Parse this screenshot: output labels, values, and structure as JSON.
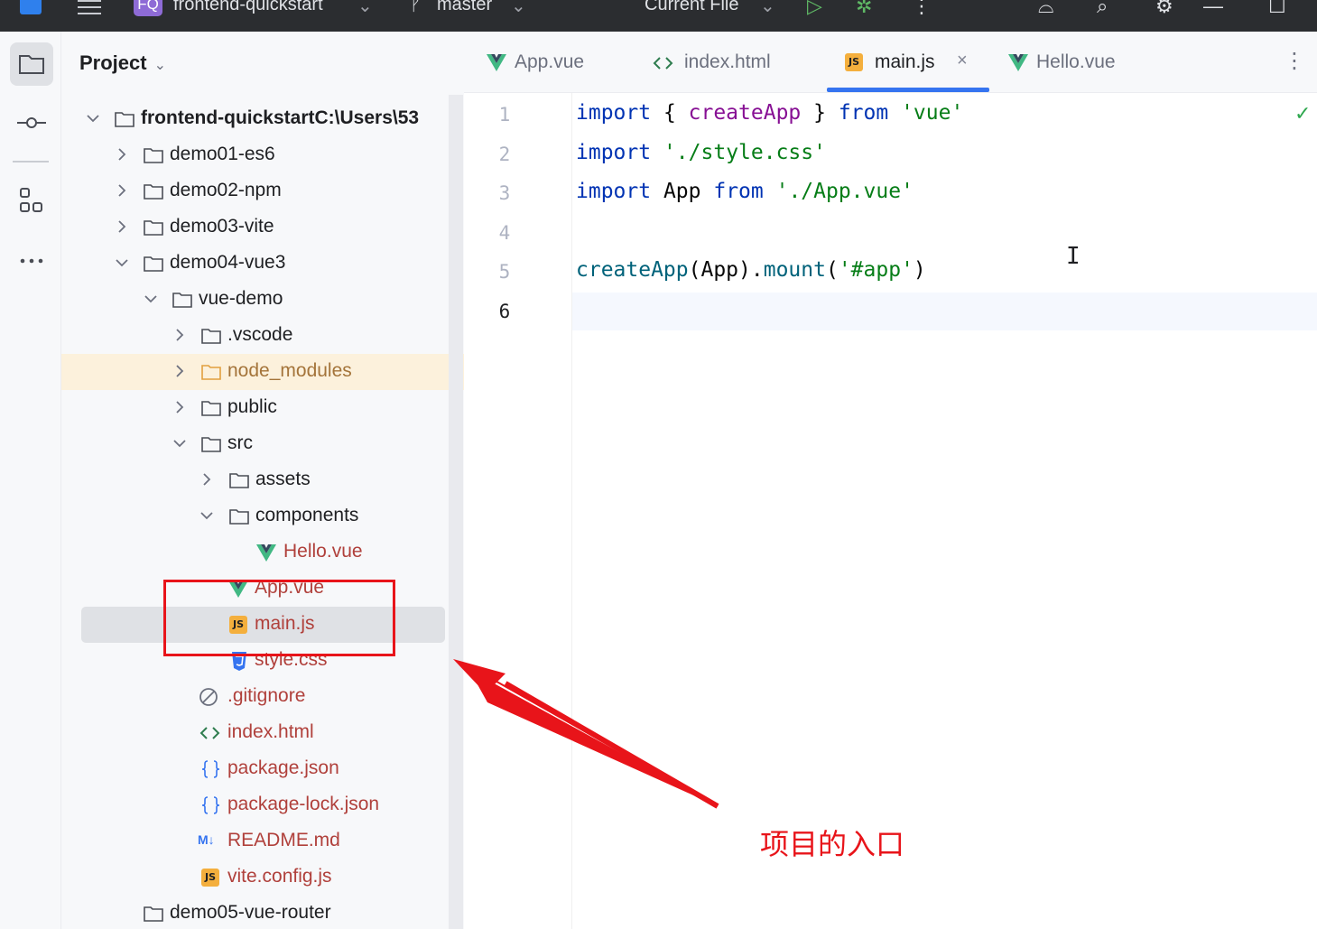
{
  "titlebar": {
    "project_badge": "FQ",
    "project_name": "frontend-quickstart",
    "branch": "master",
    "run_config": "Current File"
  },
  "project_panel": {
    "title": "Project",
    "root_name": "frontend-quickstart",
    "root_path": "C:\\Users\\53",
    "items": [
      {
        "label": "demo01-es6"
      },
      {
        "label": "demo02-npm"
      },
      {
        "label": "demo03-vite"
      },
      {
        "label": "demo04-vue3"
      },
      {
        "label": "vue-demo"
      },
      {
        "label": ".vscode"
      },
      {
        "label": "node_modules"
      },
      {
        "label": "public"
      },
      {
        "label": "src"
      },
      {
        "label": "assets"
      },
      {
        "label": "components"
      },
      {
        "label": "Hello.vue"
      },
      {
        "label": "App.vue"
      },
      {
        "label": "main.js"
      },
      {
        "label": "style.css"
      },
      {
        "label": ".gitignore"
      },
      {
        "label": "index.html"
      },
      {
        "label": "package.json"
      },
      {
        "label": "package-lock.json"
      },
      {
        "label": "README.md"
      },
      {
        "label": "vite.config.js"
      },
      {
        "label": "demo05-vue-router"
      }
    ]
  },
  "editor_tabs": [
    {
      "label": "App.vue"
    },
    {
      "label": "index.html"
    },
    {
      "label": "main.js"
    },
    {
      "label": "Hello.vue"
    }
  ],
  "code": {
    "line_numbers": [
      "1",
      "2",
      "3",
      "4",
      "5",
      "6"
    ],
    "l1": {
      "kw1": "import",
      "p1": " { ",
      "fn": "createApp",
      "p2": " } ",
      "kw2": "from",
      "sp": " ",
      "str": "'vue'"
    },
    "l2": {
      "kw1": "import",
      "sp": " ",
      "str": "'./style.css'"
    },
    "l3": {
      "kw1": "import",
      "id": " App ",
      "kw2": "from",
      "sp": " ",
      "str": "'./App.vue'"
    },
    "l5": {
      "fn": "createApp",
      "p1": "(App).",
      "mth": "mount",
      "p2": "(",
      "str": "'#app'",
      "p3": ")"
    }
  },
  "annotation": {
    "text": "项目的入口"
  },
  "colors": {
    "accent": "#3574f0",
    "annotation_red": "#e8141a",
    "vue_green": "#41b883",
    "js_yellow": "#f4af3d"
  }
}
